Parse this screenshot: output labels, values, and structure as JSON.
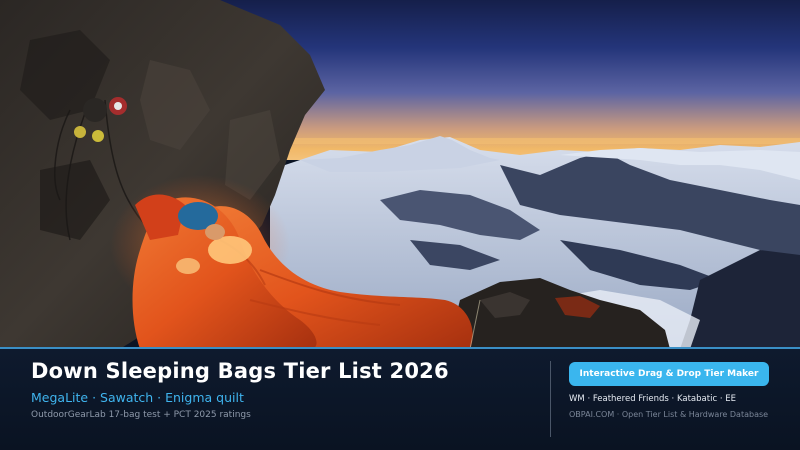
{
  "hero": {
    "image": "climbers-in-orange-sleeping-bags-on-mountain-ledge-at-dusk"
  },
  "banner": {
    "title": "Down Sleeping Bags Tier List 2026",
    "subtitle": "MegaLite · Sawatch · Enigma quilt",
    "source_note": "OutdoorGearLab 17-bag test + PCT 2025 ratings"
  },
  "sidebar": {
    "cta_label": "Interactive Drag & Drop Tier Maker",
    "brands": "WM · Feathered Friends · Katabatic · EE",
    "site": "OBPAI.COM · Open Tier List & Hardware Database"
  },
  "colors": {
    "accent": "#3ab6ee",
    "panel_bg": "#0e1a2e",
    "sleeping_bag": "#e2541c"
  }
}
